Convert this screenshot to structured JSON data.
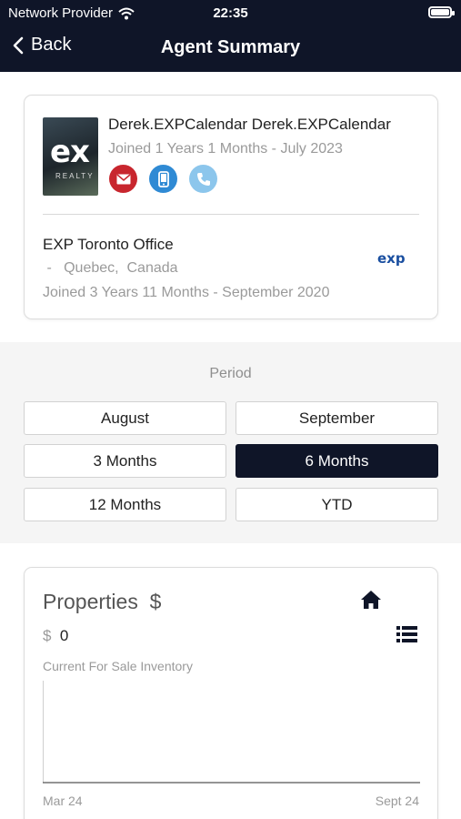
{
  "status_bar": {
    "carrier": "Network Provider",
    "time": "22:35"
  },
  "nav": {
    "back_label": "Back",
    "title": "Agent Summary"
  },
  "agent": {
    "name": "Derek.EXPCalendar Derek.EXPCalendar",
    "joined": "Joined 1 Years 1 Months - July 2023",
    "logo_text": "ex",
    "logo_subtext": "REALTY",
    "contacts": {
      "email_icon": "envelope-icon",
      "mobile_icon": "mobile-phone-icon",
      "call_icon": "phone-icon"
    },
    "colors": {
      "email": "#c8262e",
      "mobile": "#2f8ad4",
      "call": "#8cc6ec"
    }
  },
  "office": {
    "name": "EXP Toronto Office",
    "location": " -   Quebec,  Canada",
    "joined": "Joined 3 Years 11 Months - September 2020",
    "logo_text": "exp"
  },
  "period": {
    "label": "Period",
    "options": [
      "August",
      "September",
      "3 Months",
      "6 Months",
      "12 Months",
      "YTD"
    ],
    "selected": "6 Months"
  },
  "properties": {
    "title": "Properties  $",
    "currency": "$",
    "value": "0",
    "inventory_label": "Current For Sale Inventory",
    "x_start": "Mar 24",
    "x_end": "Sept 24"
  },
  "theme": {
    "navy": "#0f1528"
  }
}
